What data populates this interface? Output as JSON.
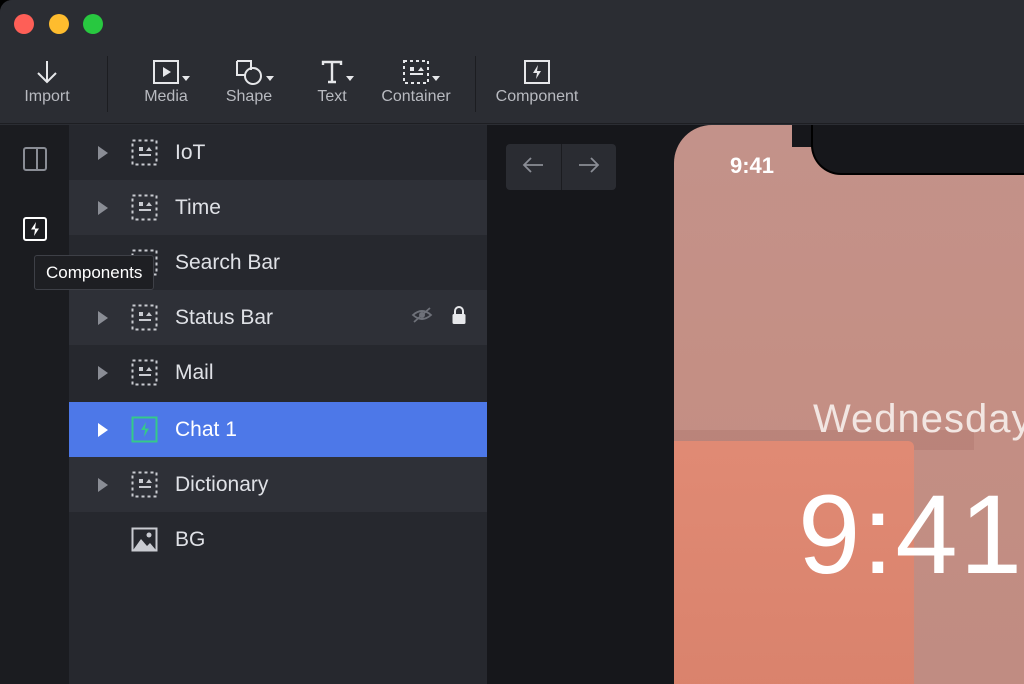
{
  "toolbar": {
    "items": [
      {
        "label": "Import",
        "icon": "download-arrow-icon"
      },
      {
        "label": "Media",
        "icon": "media-play-icon"
      },
      {
        "label": "Shape",
        "icon": "shape-icon"
      },
      {
        "label": "Text",
        "icon": "text-icon"
      },
      {
        "label": "Container",
        "icon": "container-icon"
      },
      {
        "label": "Component",
        "icon": "component-icon"
      }
    ]
  },
  "sidebar": {
    "tooltip": "Components"
  },
  "layers": [
    {
      "label": "IoT",
      "icon": "container-icon"
    },
    {
      "label": "Time",
      "icon": "container-icon"
    },
    {
      "label": "Search Bar",
      "icon": "container-icon"
    },
    {
      "label": "Status Bar",
      "icon": "container-icon",
      "hidden": true,
      "locked": true
    },
    {
      "label": "Mail",
      "icon": "container-icon"
    },
    {
      "label": "Chat 1",
      "icon": "component-icon",
      "selected": true
    },
    {
      "label": "Dictionary",
      "icon": "container-icon"
    },
    {
      "label": "BG",
      "icon": "image-icon"
    }
  ],
  "canvas": {
    "status_time": "9:41",
    "day": "Wednesday",
    "time": "9:41"
  },
  "colors": {
    "selection": "#4d78e8",
    "component_accent": "#35c98a"
  }
}
